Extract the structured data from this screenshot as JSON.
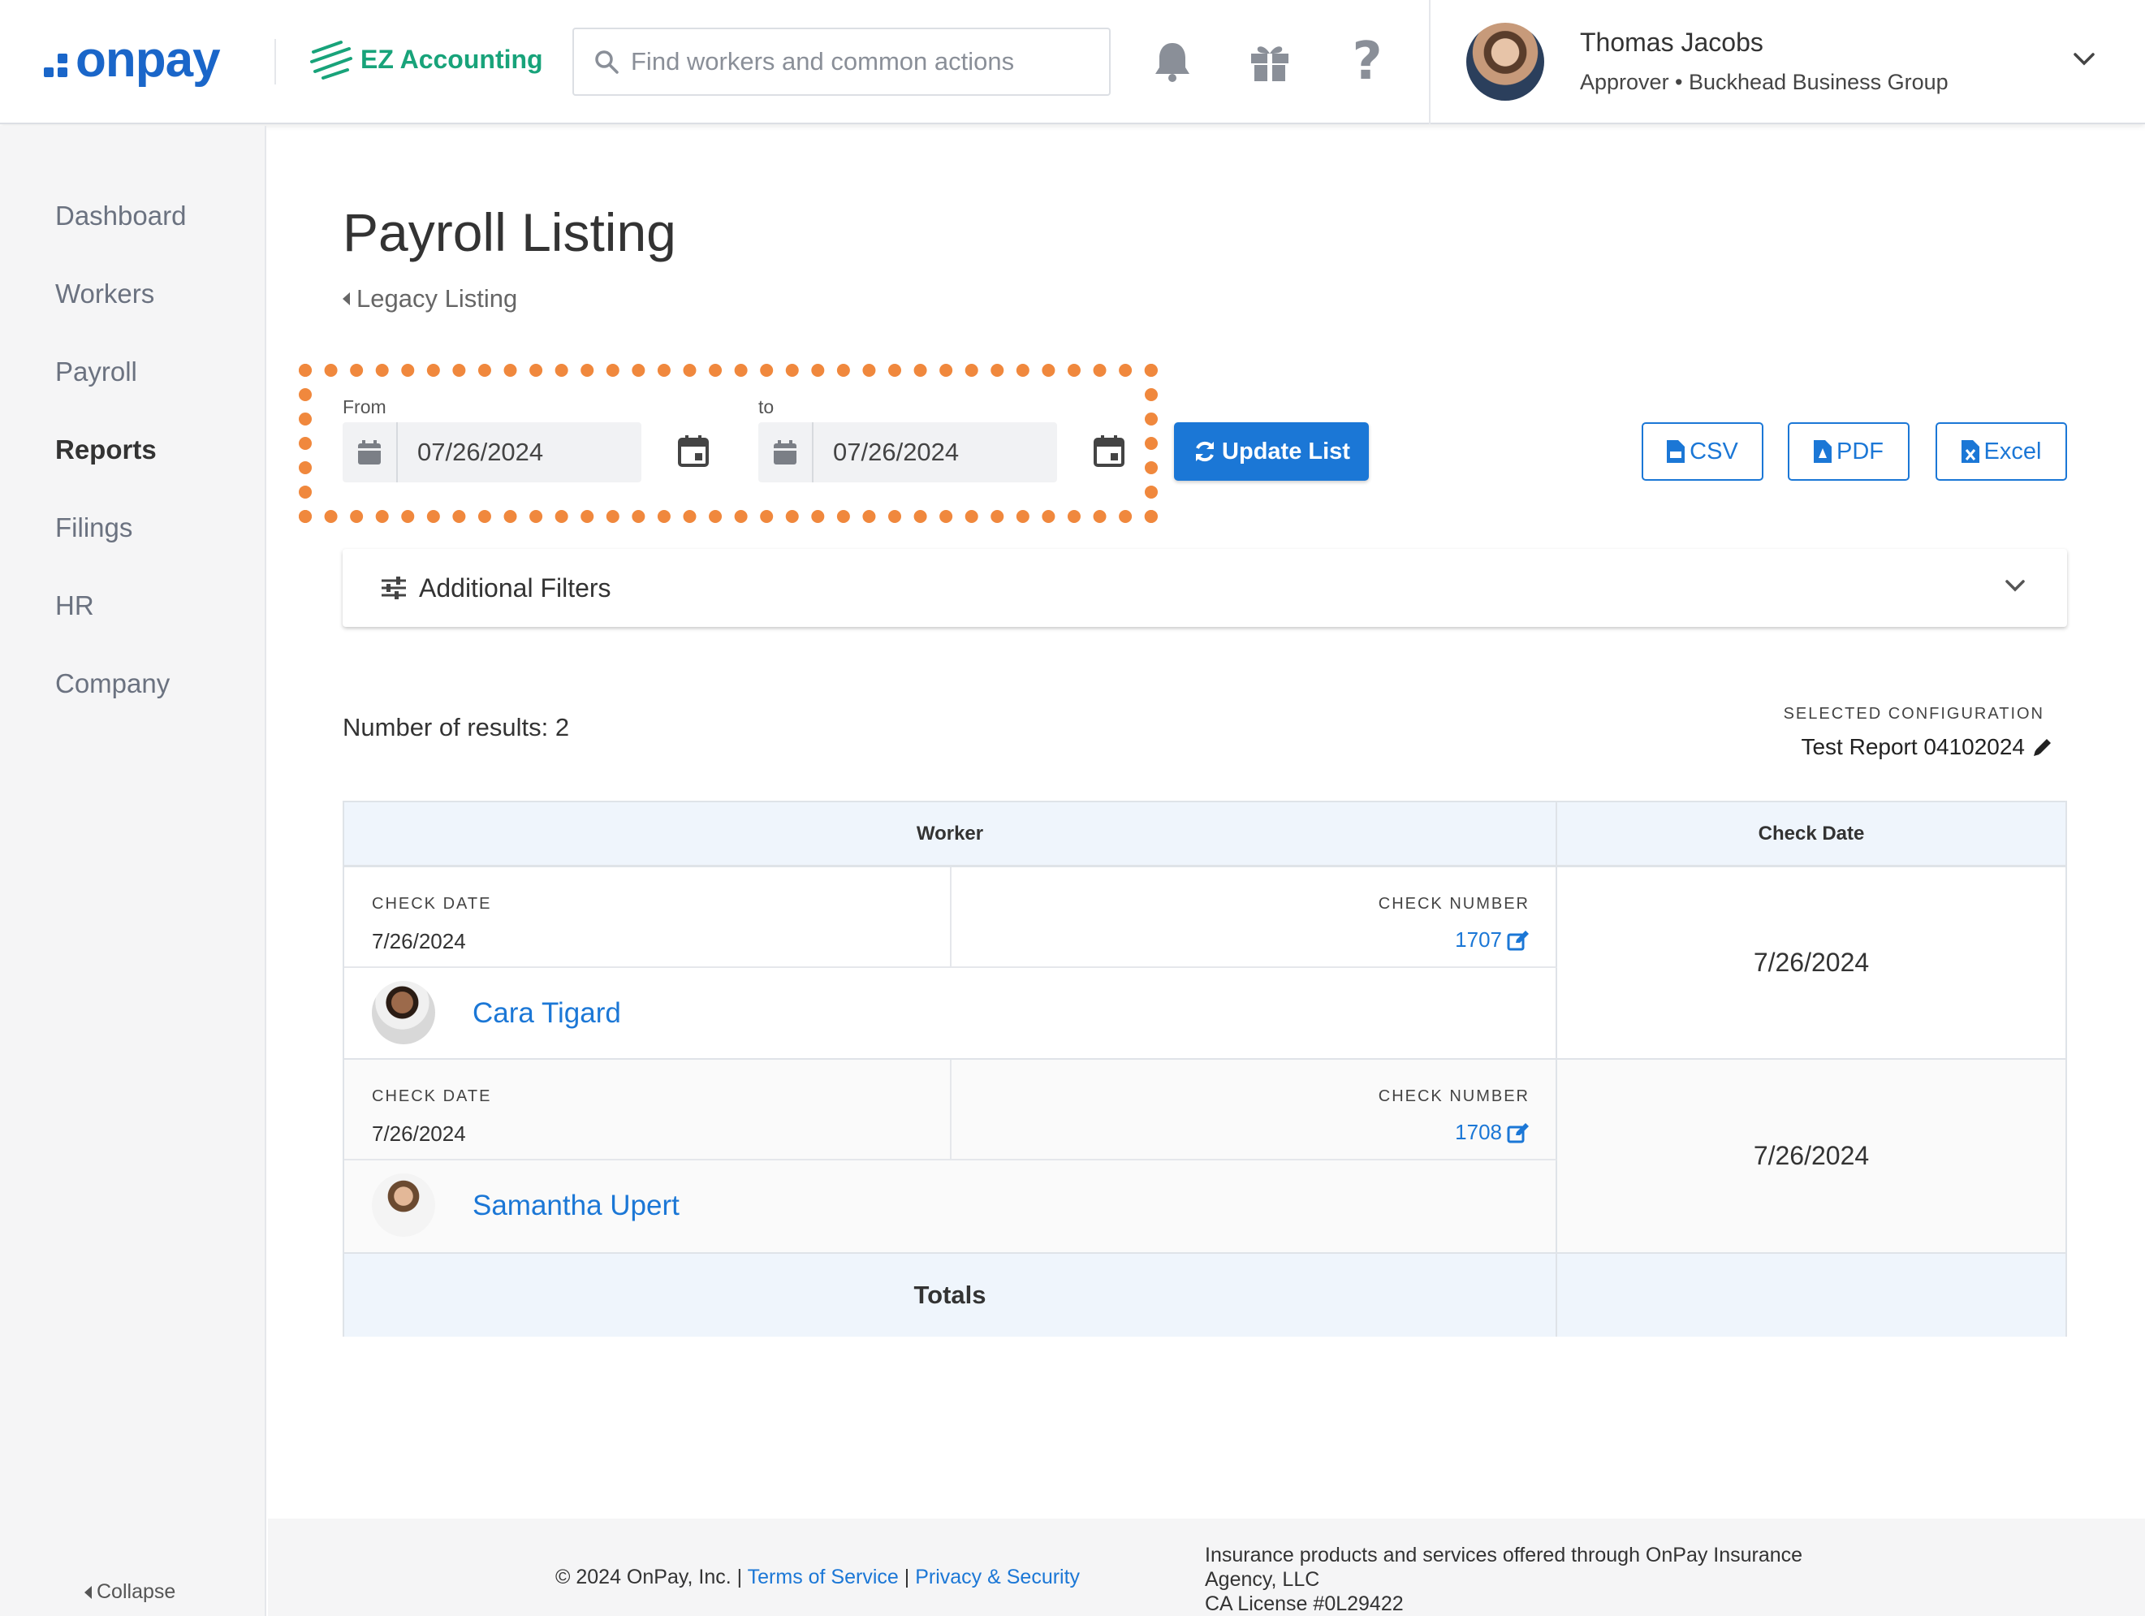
{
  "header": {
    "logo_text": "onpay",
    "partner_name": "EZ Accounting",
    "search_placeholder": "Find workers and common actions",
    "user": {
      "name": "Thomas Jacobs",
      "role": "Approver • Buckhead Business Group"
    },
    "icons": [
      "bell-icon",
      "gift-icon",
      "help-icon",
      "chevron-down-icon"
    ]
  },
  "sidebar": {
    "items": [
      {
        "label": "Dashboard",
        "active": false
      },
      {
        "label": "Workers",
        "active": false
      },
      {
        "label": "Payroll",
        "active": false
      },
      {
        "label": "Reports",
        "active": true
      },
      {
        "label": "Filings",
        "active": false
      },
      {
        "label": "HR",
        "active": false
      },
      {
        "label": "Company",
        "active": false
      }
    ],
    "collapse_label": "Collapse"
  },
  "page": {
    "title": "Payroll Listing",
    "back_link": "Legacy Listing"
  },
  "date_range": {
    "from_label": "From",
    "from_value": "07/26/2024",
    "to_label": "to",
    "to_value": "07/26/2024"
  },
  "actions": {
    "update_label": "Update List",
    "csv_label": "CSV",
    "pdf_label": "PDF",
    "excel_label": "Excel"
  },
  "filters": {
    "label": "Additional Filters"
  },
  "results": {
    "count_text": "Number of results: 2",
    "config_label": "SELECTED CONFIGURATION",
    "config_value": "Test Report 04102024"
  },
  "table": {
    "columns": [
      "Worker",
      "Check Date"
    ],
    "check_date_label": "CHECK DATE",
    "check_number_label": "CHECK NUMBER",
    "rows": [
      {
        "check_date": "7/26/2024",
        "check_number": "1707",
        "worker": "Cara Tigard",
        "date": "7/26/2024"
      },
      {
        "check_date": "7/26/2024",
        "check_number": "1708",
        "worker": "Samantha Upert",
        "date": "7/26/2024"
      }
    ],
    "totals_label": "Totals"
  },
  "footer": {
    "copyright": "© 2024 OnPay, Inc. |",
    "terms": "Terms of Service",
    "sep": "|",
    "privacy": "Privacy & Security",
    "insurance_line1": "Insurance products and services offered through OnPay Insurance",
    "insurance_line2": "Agency, LLC",
    "insurance_line3": "CA License #0L29422"
  },
  "colors": {
    "brand_blue": "#1a66c9",
    "link_blue": "#1b77d6",
    "ez_green": "#18a37a",
    "highlight_orange": "#f0883d"
  }
}
